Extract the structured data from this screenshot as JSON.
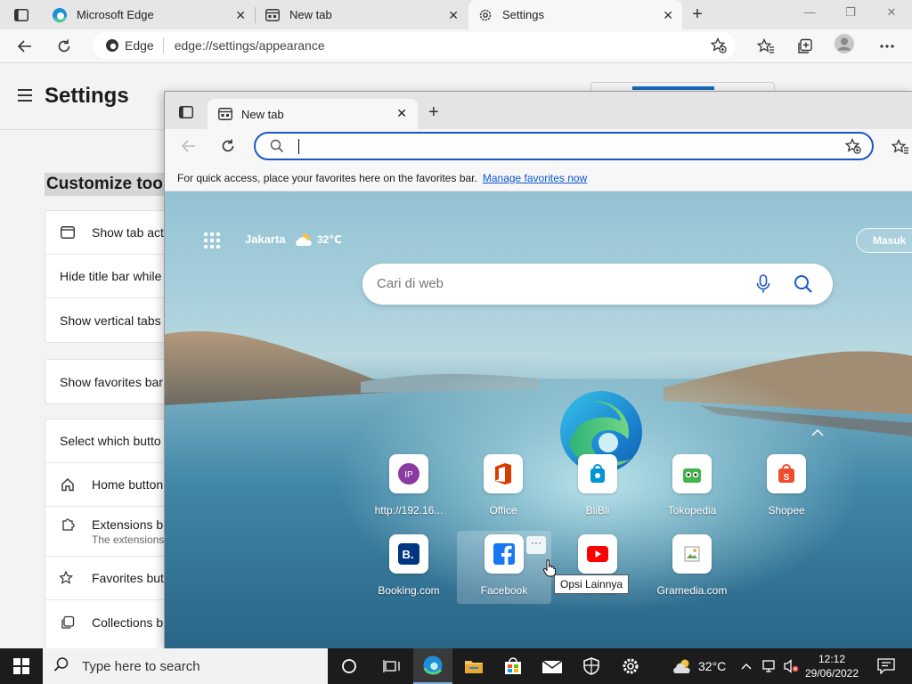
{
  "browser": {
    "tabs": [
      {
        "label": "Microsoft Edge"
      },
      {
        "label": "New tab"
      },
      {
        "label": "Settings"
      }
    ],
    "address_chip": "Edge",
    "url": "edge://settings/appearance"
  },
  "settings": {
    "title": "Settings",
    "section": "Customize tool",
    "card1": [
      "Show tab act",
      "Hide title bar while",
      "Show vertical tabs"
    ],
    "card2": [
      "Show favorites bar"
    ],
    "card3": {
      "header": "Select which butto",
      "rows": [
        "Home button",
        "Extensions bu",
        "Favorites butt",
        "Collections b"
      ],
      "extensions_sub": "The extensions"
    }
  },
  "popup": {
    "tab_label": "New tab",
    "favbar_text": "For quick access, place your favorites here on the favorites bar.",
    "favbar_link": "Manage favorites now",
    "ntp": {
      "city": "Jakarta",
      "temp": "32℃",
      "signin": "Masuk",
      "search_placeholder": "Cari di web",
      "tiles": [
        {
          "label": "http://192.16...",
          "icon_text": "IP"
        },
        {
          "label": "Office"
        },
        {
          "label": "BliBli"
        },
        {
          "label": "Tokopedia"
        },
        {
          "label": "Shopee"
        },
        {
          "label": "Booking.com",
          "icon_text": "B."
        },
        {
          "label": "Facebook"
        },
        {
          "label": "YouTube"
        },
        {
          "label": "Gramedia.com"
        }
      ],
      "more_label": "···",
      "tooltip": "Opsi Lainnya"
    }
  },
  "taskbar": {
    "search_placeholder": "Type here to search",
    "weather": "32°C",
    "time": "12:12",
    "date": "29/06/2022"
  },
  "colors": {
    "accent": "#1a57c4",
    "link": "#0b57d0",
    "taskbar": "#1c1c1c"
  }
}
